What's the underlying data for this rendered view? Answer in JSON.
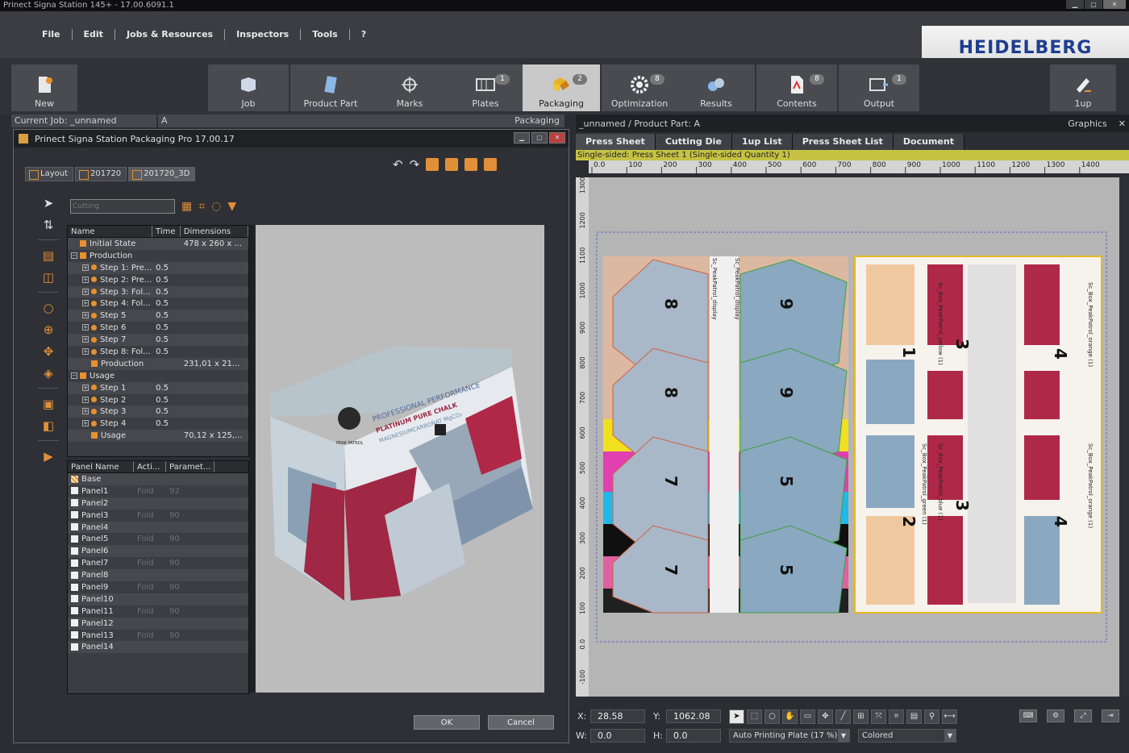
{
  "window": {
    "title": "Prinect Signa Station 145+  -  17.00.6091.1"
  },
  "menu": [
    "File",
    "Edit",
    "Jobs & Resources",
    "Inspectors",
    "Tools",
    "?"
  ],
  "logo": "HEIDELBERG",
  "toolbar": {
    "new_label": "New",
    "oneup_label": "1up",
    "workflow": [
      {
        "label": "Job",
        "badge": ""
      },
      {
        "label": "Product Part",
        "badge": ""
      },
      {
        "label": "Marks",
        "badge": ""
      },
      {
        "label": "Plates",
        "badge": "1"
      },
      {
        "label": "Packaging",
        "badge": "2"
      },
      {
        "label": "Optimization",
        "badge": "8"
      },
      {
        "label": "Results",
        "badge": ""
      },
      {
        "label": "Contents",
        "badge": "8"
      },
      {
        "label": "Output",
        "badge": "1"
      }
    ]
  },
  "left_header": {
    "current_job": "Current Job: _unnamed",
    "part": "A",
    "mode": "Packaging"
  },
  "dialog": {
    "title": "Prinect Signa Station Packaging Pro 17.00.17",
    "tabs": [
      "Layout",
      "201720",
      "201720_3D"
    ],
    "cutting_placeholder": "Cutting",
    "ok_label": "OK",
    "cancel_label": "Cancel",
    "tree": {
      "headers": [
        "Name",
        "Time",
        "Dimensions"
      ],
      "rows": [
        {
          "indent": 0,
          "expander": "",
          "marker": "box",
          "name": "Initial State",
          "time": "",
          "dims": "478 x 260 x ..."
        },
        {
          "indent": 0,
          "expander": "−",
          "marker": "box",
          "name": "Production",
          "time": "",
          "dims": ""
        },
        {
          "indent": 1,
          "expander": "+",
          "marker": "dot",
          "name": "Step 1: Pre...",
          "time": "0.5",
          "dims": ""
        },
        {
          "indent": 1,
          "expander": "+",
          "marker": "dot",
          "name": "Step 2: Pre...",
          "time": "0.5",
          "dims": ""
        },
        {
          "indent": 1,
          "expander": "+",
          "marker": "dot",
          "name": "Step 3: Fol...",
          "time": "0.5",
          "dims": ""
        },
        {
          "indent": 1,
          "expander": "+",
          "marker": "dot",
          "name": "Step 4: Fol...",
          "time": "0.5",
          "dims": ""
        },
        {
          "indent": 1,
          "expander": "+",
          "marker": "dot",
          "name": "Step 5",
          "time": "0.5",
          "dims": ""
        },
        {
          "indent": 1,
          "expander": "+",
          "marker": "dot",
          "name": "Step 6",
          "time": "0.5",
          "dims": ""
        },
        {
          "indent": 1,
          "expander": "+",
          "marker": "dot",
          "name": "Step 7",
          "time": "0.5",
          "dims": ""
        },
        {
          "indent": 1,
          "expander": "+",
          "marker": "dot",
          "name": "Step 8: Fol...",
          "time": "0.5",
          "dims": ""
        },
        {
          "indent": 1,
          "expander": "",
          "marker": "box",
          "name": "Production",
          "time": "",
          "dims": "231,01 x 21..."
        },
        {
          "indent": 0,
          "expander": "−",
          "marker": "box",
          "name": "Usage",
          "time": "",
          "dims": ""
        },
        {
          "indent": 1,
          "expander": "+",
          "marker": "dot",
          "name": "Step 1",
          "time": "0.5",
          "dims": ""
        },
        {
          "indent": 1,
          "expander": "+",
          "marker": "dot",
          "name": "Step 2",
          "time": "0.5",
          "dims": ""
        },
        {
          "indent": 1,
          "expander": "+",
          "marker": "dot",
          "name": "Step 3",
          "time": "0.5",
          "dims": ""
        },
        {
          "indent": 1,
          "expander": "+",
          "marker": "dot",
          "name": "Step 4",
          "time": "0.5",
          "dims": ""
        },
        {
          "indent": 1,
          "expander": "",
          "marker": "box",
          "name": "Usage",
          "time": "",
          "dims": "70,12 x 125,..."
        }
      ]
    },
    "panels": {
      "headers": [
        "Panel Name",
        "Acti...",
        "Paramet..."
      ],
      "rows": [
        {
          "name": "Base",
          "action": "",
          "param": ""
        },
        {
          "name": "Panel1",
          "action": "Fold",
          "param": "92"
        },
        {
          "name": "Panel2",
          "action": "",
          "param": ""
        },
        {
          "name": "Panel3",
          "action": "Fold",
          "param": "90"
        },
        {
          "name": "Panel4",
          "action": "",
          "param": ""
        },
        {
          "name": "Panel5",
          "action": "Fold",
          "param": "90"
        },
        {
          "name": "Panel6",
          "action": "",
          "param": ""
        },
        {
          "name": "Panel7",
          "action": "Fold",
          "param": "90"
        },
        {
          "name": "Panel8",
          "action": "",
          "param": ""
        },
        {
          "name": "Panel9",
          "action": "Fold",
          "param": "90"
        },
        {
          "name": "Panel10",
          "action": "",
          "param": ""
        },
        {
          "name": "Panel11",
          "action": "Fold",
          "param": "90"
        },
        {
          "name": "Panel12",
          "action": "",
          "param": ""
        },
        {
          "name": "Panel13",
          "action": "Fold",
          "param": "90"
        },
        {
          "name": "Panel14",
          "action": "",
          "param": ""
        }
      ]
    },
    "box_text": {
      "line1": "PROFESSIONAL PERFORMANCE",
      "line2": "PLATINUM PURE CHALK",
      "line3": "MAGNESIUMCARBONAT MgCO₃",
      "brand": "PEAK PATROL"
    }
  },
  "right": {
    "path": "_unnamed / Product Part: A",
    "mode": "Graphics",
    "tabs": [
      "Press Sheet",
      "Cutting Die",
      "1up List",
      "Press Sheet List",
      "Document"
    ],
    "sheet_info": "Single-sided:  Press Sheet 1 (Single-sided Quantity 1)",
    "ruler_h": [
      "0.0",
      "100",
      "200",
      "300",
      "400",
      "500",
      "600",
      "700",
      "800",
      "900",
      "1000",
      "1100",
      "1200",
      "1300",
      "1400"
    ],
    "ruler_v": [
      "1300",
      "1200",
      "1100",
      "1000",
      "900",
      "800",
      "700",
      "600",
      "500",
      "400",
      "300",
      "200",
      "100",
      "0.0",
      "-100"
    ],
    "left_numbers": [
      "8",
      "8",
      "7",
      "7"
    ],
    "left_numbers2": [
      "9",
      "9",
      "5",
      "5"
    ],
    "right_numbers": [
      "1",
      "3",
      "4",
      "2",
      "3",
      "4"
    ],
    "side_labels": [
      "Sc_Box_PeakPatrol_yellow (1)",
      "Sc_Box_PeakPatrol_orange (1)",
      "Sc_Box_PeakPatrol_green (1)",
      "Sc_Box_PeakPatrol_blue (1)",
      "Sc_Box_PeakPatrol_orange (1)",
      "Sc_PeakPatrol_display",
      "Sc_PeakPatrol_display"
    ],
    "status": {
      "x_label": "X:",
      "x_value": "28.58",
      "y_label": "Y:",
      "y_value": "1062.08",
      "w_label": "W:",
      "w_value": "0.0",
      "h_label": "H:",
      "h_value": "0.0",
      "plate_select": "Auto Printing Plate (17 %)",
      "color_select": "Colored"
    }
  }
}
